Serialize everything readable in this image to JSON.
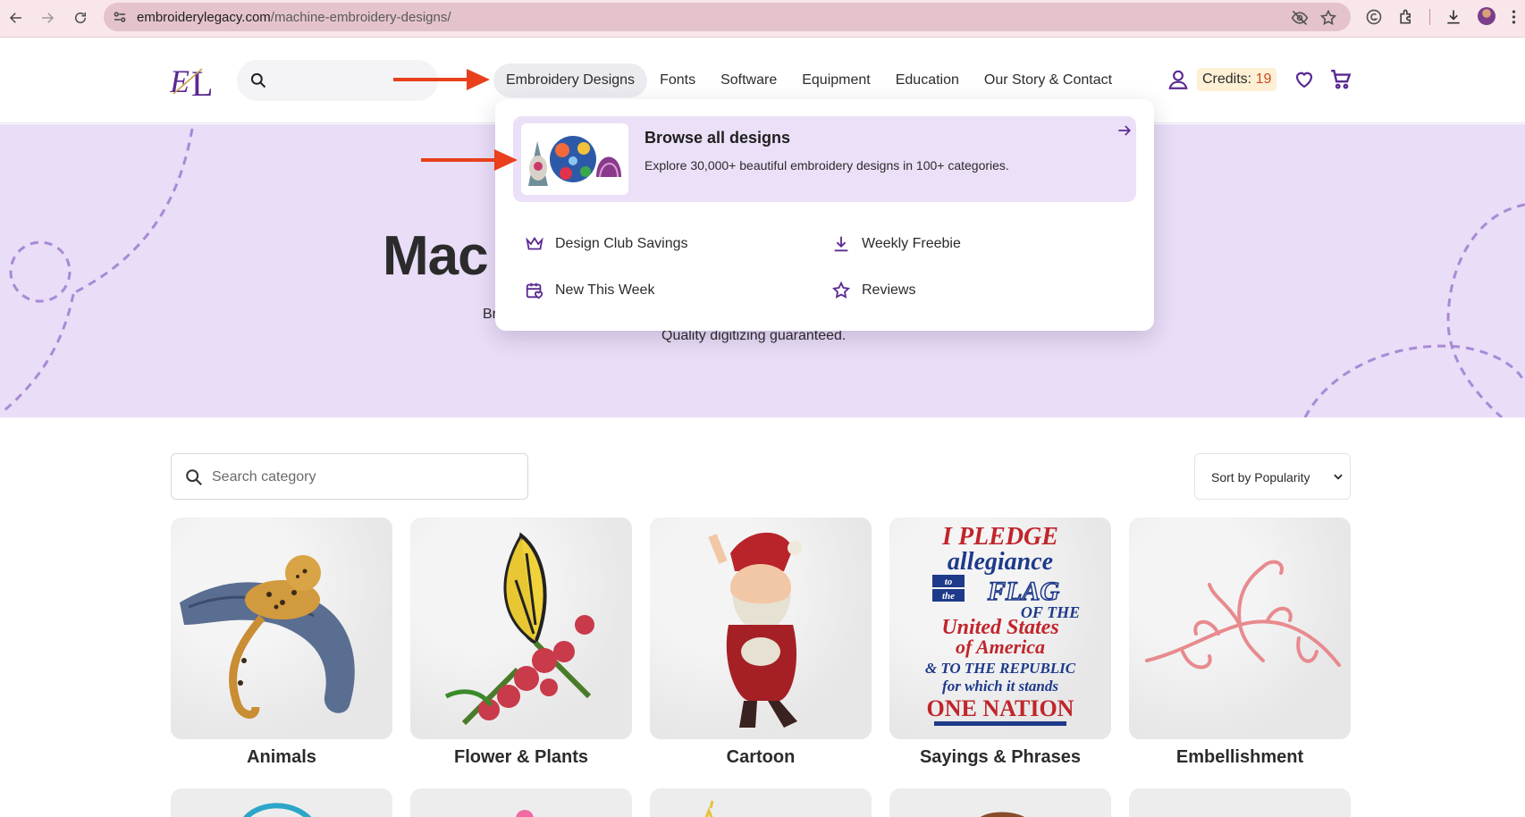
{
  "browser": {
    "url_host": "embroiderylegacy.com",
    "url_path": "/machine-embroidery-designs/"
  },
  "header": {
    "logo_text": "EL",
    "nav": [
      {
        "label": "Embroidery Designs"
      },
      {
        "label": "Fonts"
      },
      {
        "label": "Software"
      },
      {
        "label": "Equipment"
      },
      {
        "label": "Education"
      },
      {
        "label": "Our Story & Contact"
      }
    ],
    "credits_label": "Credits:",
    "credits_value": "19"
  },
  "hero": {
    "title": "Mac",
    "subtitle_start": "Br",
    "subtitle_line2": "Quality digitizing guaranteed."
  },
  "dropdown": {
    "browse_title": "Browse all designs",
    "browse_desc": "Explore 30,000+ beautiful embroidery designs in 100+ categories.",
    "links": [
      {
        "label": "Design Club Savings",
        "icon": "crown-icon"
      },
      {
        "label": "Weekly Freebie",
        "icon": "download-icon"
      },
      {
        "label": "New This Week",
        "icon": "calendar-heart-icon"
      },
      {
        "label": "Reviews",
        "icon": "star-icon"
      }
    ]
  },
  "categories": {
    "search_placeholder": "Search category",
    "sort_label": "Sort by Popularity",
    "items": [
      {
        "label": "Animals"
      },
      {
        "label": "Flower & Plants"
      },
      {
        "label": "Cartoon"
      },
      {
        "label": "Sayings & Phrases"
      },
      {
        "label": "Embellishment"
      }
    ],
    "pledge_lines": [
      "I PLEDGE",
      "allegiance",
      "to",
      "the",
      "FLAG",
      "OF THE",
      "United States",
      "of America",
      "& TO THE REPUBLIC",
      "for which it stands",
      "ONE NATION"
    ]
  },
  "colors": {
    "brand_purple": "#5b2a91",
    "hero_bg": "#e9ddf7",
    "card_highlight": "#ebe0f8",
    "credits_bg": "#fdf0d5",
    "credits_accent": "#d0481f",
    "annotation_arrow": "#e8401c"
  }
}
